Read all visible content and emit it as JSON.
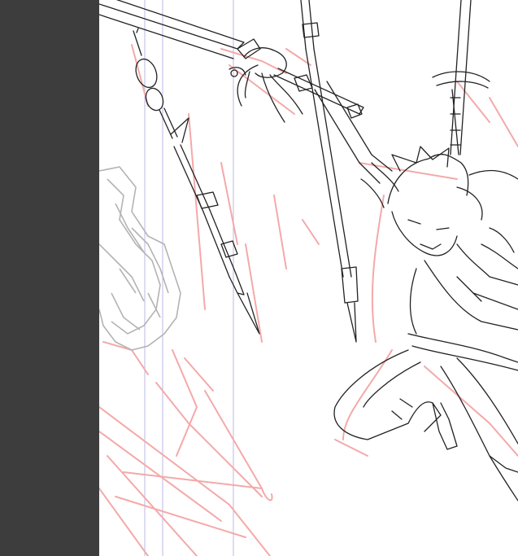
{
  "app": {
    "sidebar_color": "#3d3d3d",
    "canvas_color": "#ffffff",
    "sketch_color": "#f2a8a8",
    "lineart_color": "#222222",
    "guide_color": "#9a9ad8",
    "rough_layer_color": "#b8b8b8"
  },
  "artwork": {
    "layers": [
      "guide-lines",
      "rough-sketch-layer",
      "line-art-layer",
      "gray-rough-cluster"
    ]
  }
}
